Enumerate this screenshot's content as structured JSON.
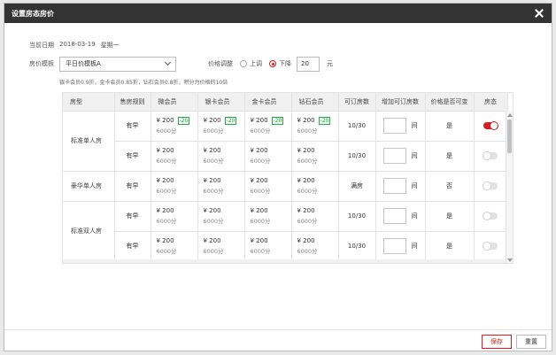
{
  "dialog": {
    "title": "设置房态房价",
    "close_icon": "close-icon"
  },
  "date": {
    "label": "当前日期",
    "value": "2018-03-19",
    "weekday": "星期一"
  },
  "template": {
    "label": "房价模板",
    "value": "平日价模板A"
  },
  "adjust": {
    "label": "价格调整",
    "up_label": "上调",
    "down_label": "下降",
    "selected": "down",
    "amount": "20",
    "unit": "元"
  },
  "note": "银卡会员0.9折，金卡会员0.85折，钻石会员0.8折，积分为价格的10倍",
  "table": {
    "headers": [
      "房型",
      "售房规则",
      "微会员",
      "银卡会员",
      "金卡会员",
      "钻石会员",
      "可订房数",
      "增加可订房数",
      "价格是否可变",
      "房态"
    ],
    "groups": [
      {
        "room_type": "标准单人房",
        "rows": [
          {
            "rule": "有早",
            "prices": [
              {
                "price": "¥ 200",
                "tag": "-20",
                "points": "6000分"
              },
              {
                "price": "¥ 200",
                "tag": "-20",
                "points": "6000分"
              },
              {
                "price": "¥ 200",
                "tag": "-20",
                "points": "6000分"
              },
              {
                "price": "¥ 200",
                "tag": "-20",
                "points": "6000分"
              }
            ],
            "available": "10/30",
            "add_unit": "间",
            "price_variable": "是",
            "status_on": true
          },
          {
            "rule": "有早",
            "prices": [
              {
                "price": "¥ 200",
                "points": "6000分"
              },
              {
                "price": "¥ 200",
                "points": "6000分"
              },
              {
                "price": "¥ 200",
                "points": "6000分"
              },
              {
                "price": "¥ 200",
                "points": "6000分"
              }
            ],
            "available": "10/30",
            "add_unit": "间",
            "price_variable": "是",
            "status_on": false
          }
        ]
      },
      {
        "room_type": "豪华单人房",
        "rows": [
          {
            "rule": "有早",
            "prices": [
              {
                "price": "¥ 200",
                "points": "6000分"
              },
              {
                "price": "¥ 200",
                "points": "6000分"
              },
              {
                "price": "¥ 200",
                "points": "6000分"
              },
              {
                "price": "¥ 200",
                "points": "6000分"
              }
            ],
            "available": "满房",
            "add_unit": "间",
            "price_variable": "否",
            "status_on": false
          }
        ]
      },
      {
        "room_type": "标准双人房",
        "rows": [
          {
            "rule": "有早",
            "prices": [
              {
                "price": "¥ 200",
                "points": "6000分"
              },
              {
                "price": "¥ 200",
                "points": "6000分"
              },
              {
                "price": "¥ 200",
                "points": "6000分"
              },
              {
                "price": "¥ 200",
                "points": "6000分"
              }
            ],
            "available": "10/30",
            "add_unit": "间",
            "price_variable": "是",
            "status_on": false
          },
          {
            "rule": "有早",
            "prices": [
              {
                "price": "¥ 200",
                "points": "6000分"
              },
              {
                "price": "¥ 200",
                "points": "6000分"
              },
              {
                "price": "¥ 200",
                "points": "6000分"
              },
              {
                "price": "¥ 200",
                "points": "6000分"
              }
            ],
            "available": "10/30",
            "add_unit": "间",
            "price_variable": "是",
            "status_on": false
          }
        ]
      }
    ]
  },
  "footer": {
    "save_label": "保存",
    "reset_label": "重置"
  },
  "colors": {
    "accent": "#d21f1f",
    "tag_green": "#2aa84a",
    "titlebar": "#333333"
  }
}
